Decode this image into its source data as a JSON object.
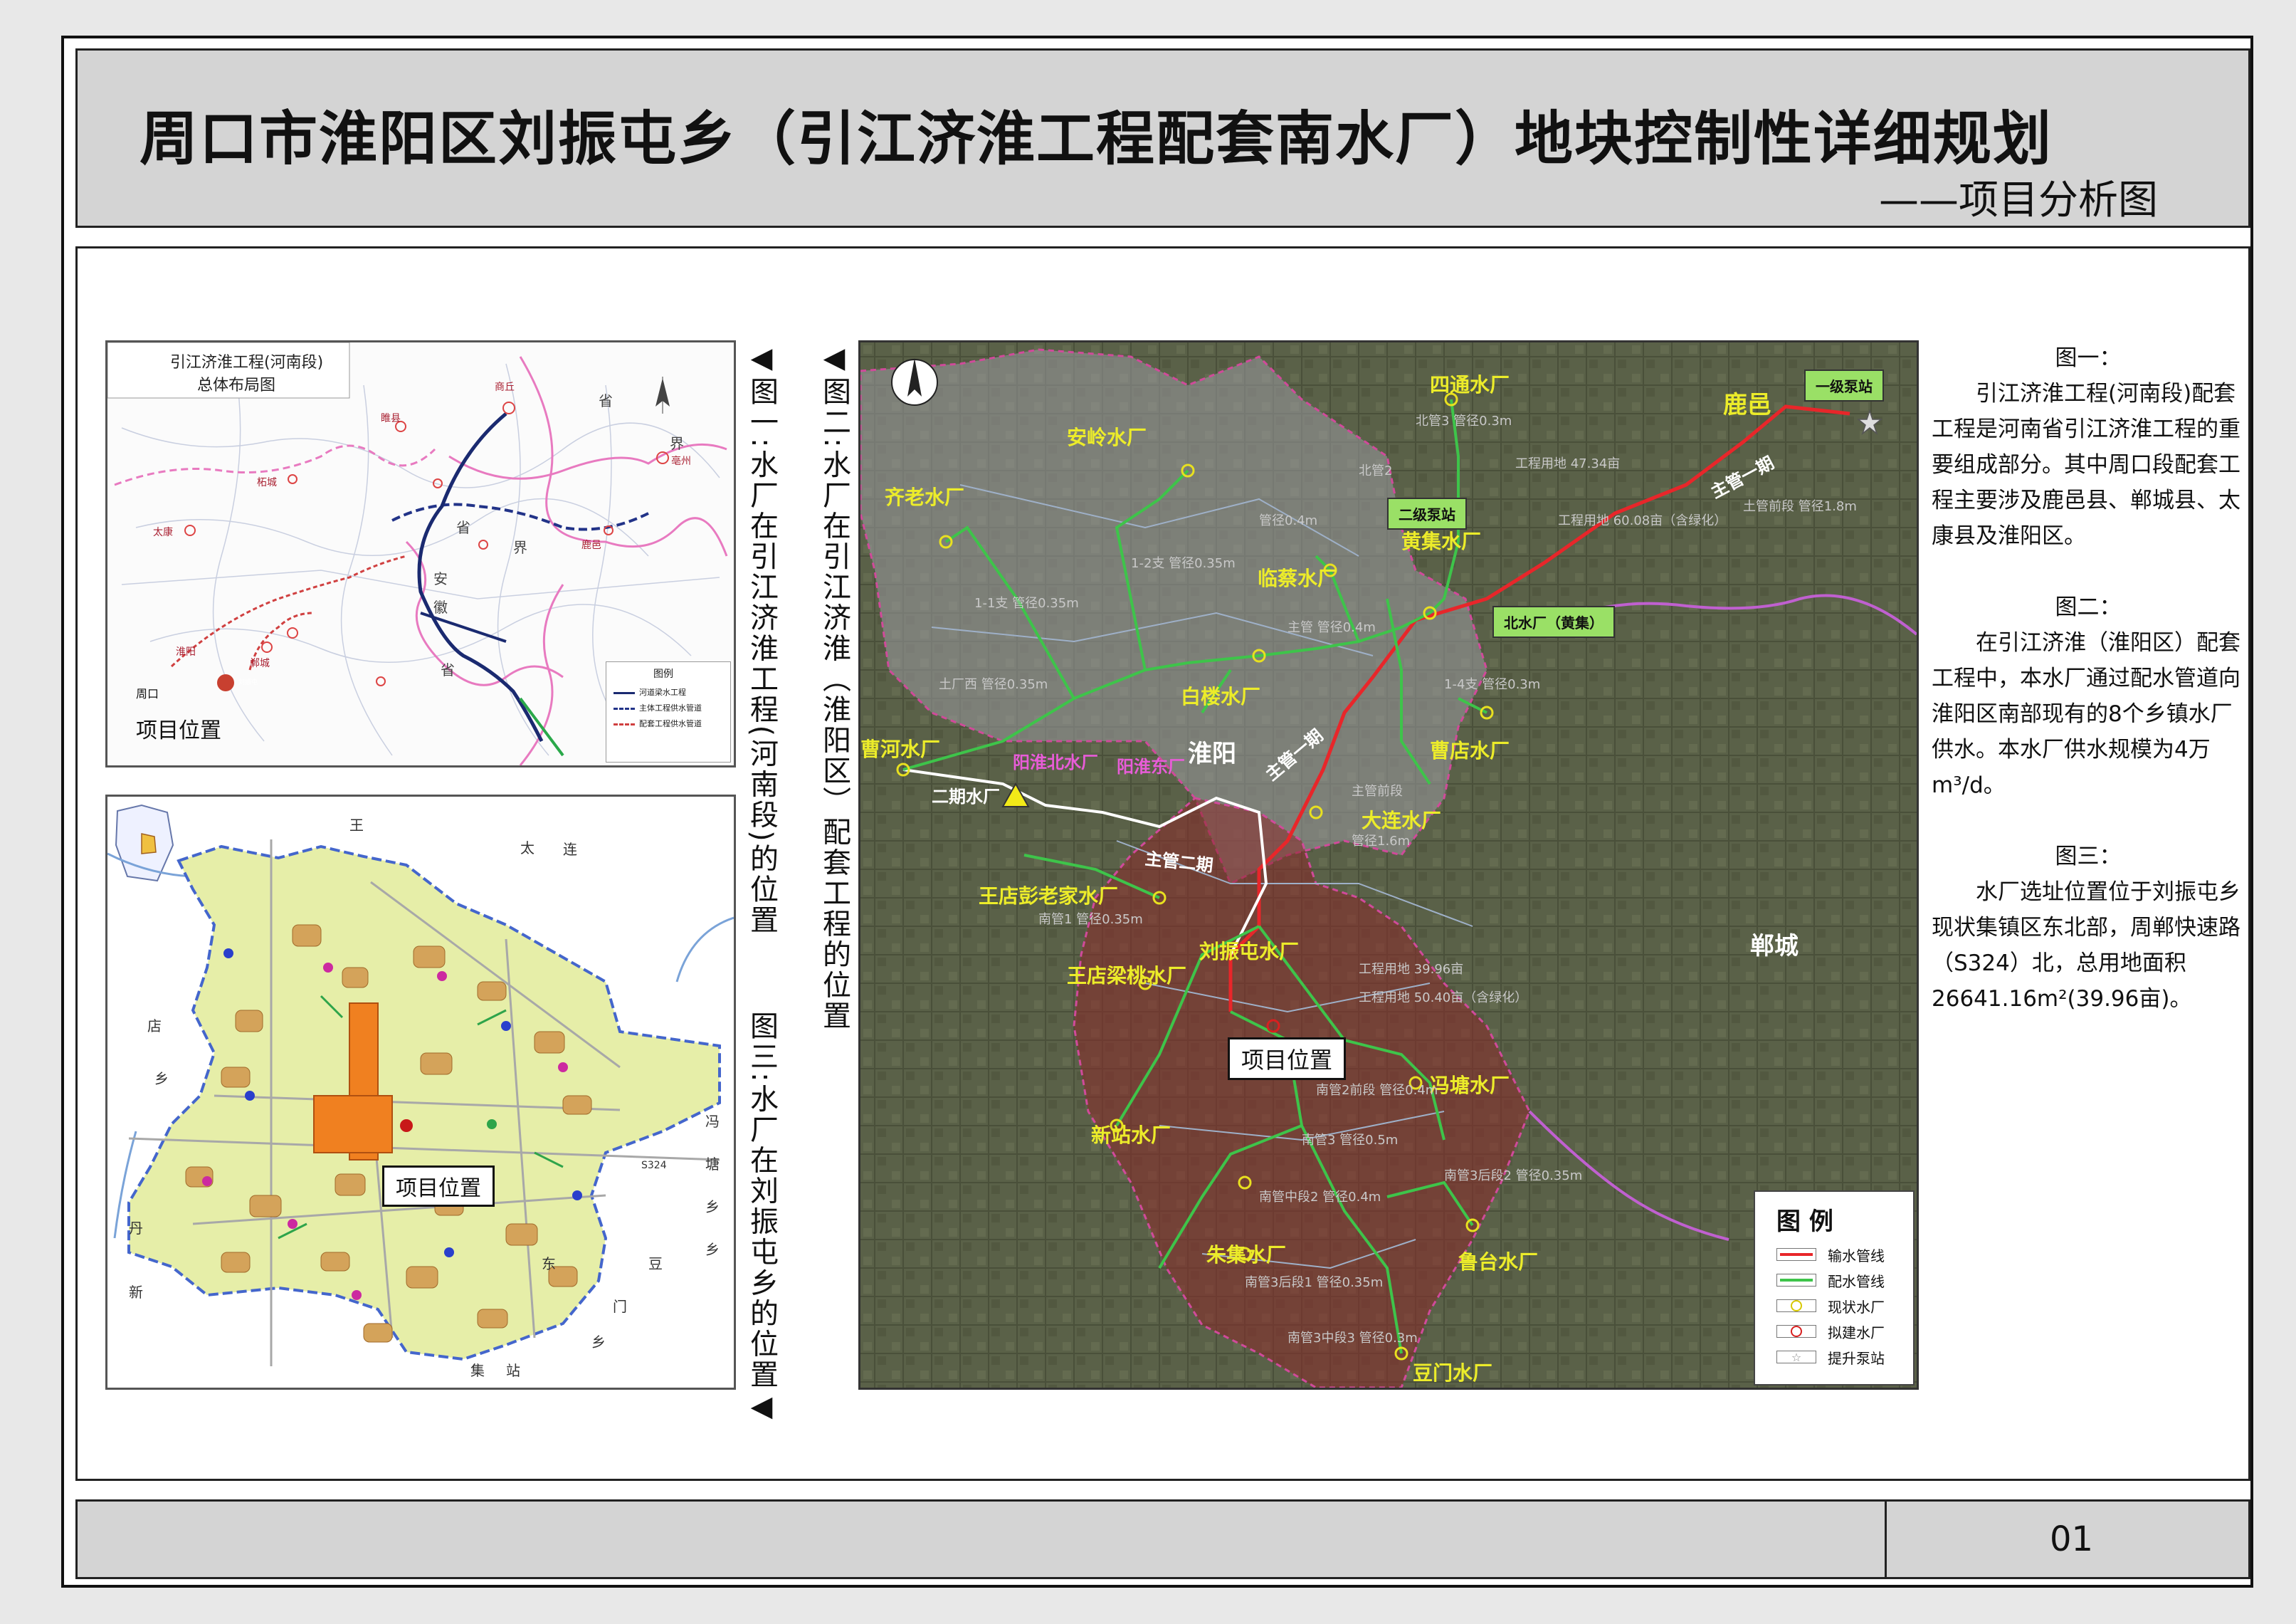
{
  "header": {
    "title": "周口市淮阳区刘振屯乡（引江济淮工程配套南水厂）地块控制性详细规划",
    "subtitle": "——项目分析图"
  },
  "footer": {
    "page_number": "01"
  },
  "captions": {
    "fig1": "◀图一:水厂在引江济淮工程(河南段)的位置",
    "fig2": "◀图二:水厂在引江济淮（淮阳区）配套工程的位置",
    "fig3": "图三:水厂在刘振屯乡的位置◀"
  },
  "fig1_map": {
    "title_line1": "引江济淮工程(河南段)",
    "title_line2": "总体布局图",
    "project_label": "项目位置",
    "legend_title": "图例",
    "legend_items": [
      "河道梁水工程",
      "主体工程供水管道",
      "配套工程供水管道"
    ],
    "province_labels": [
      "省",
      "界",
      "省",
      "安",
      "徽",
      "界",
      "省"
    ],
    "city_labels": [
      "商丘",
      "睢县",
      "柘城",
      "太康",
      "鹿邑",
      "淮阳",
      "周口",
      "郸城",
      "亳州"
    ],
    "small_label": "刘振屯"
  },
  "fig3_map": {
    "project_label": "项目位置",
    "road_label": "S324",
    "edge_chars": [
      "太",
      "王",
      "店",
      "乡",
      "冯",
      "塘",
      "乡",
      "豆",
      "门",
      "乡",
      "新",
      "站",
      "集",
      "东",
      "连",
      "乡",
      "丹"
    ]
  },
  "fig2_map": {
    "city_labels": [
      "淮阳",
      "郸城",
      "鹿邑"
    ],
    "project_label": "项目位置",
    "plant_labels": [
      "四通水厂",
      "安岭水厂",
      "齐老水厂",
      "黄集水厂",
      "临蔡水厂",
      "白楼水厂",
      "曹河水厂",
      "曹店水厂",
      "大连水厂",
      "王店彭老家水厂",
      "王店梁桃水厂",
      "刘振屯水厂",
      "冯塘水厂",
      "新站水厂",
      "朱集水厂",
      "鲁台水厂",
      "豆门水厂"
    ],
    "magenta_labels": [
      "阳淮北水厂",
      "阳淮东厂"
    ],
    "white_labels": [
      "二期水厂"
    ],
    "route_labels": [
      "主管一期",
      "主管一期",
      "主管二期"
    ],
    "tags": [
      "一级泵站",
      "二级泵站",
      "北水厂（黄集）"
    ],
    "pipe_notes": [
      "北管3 管径0.3m",
      "北管2",
      "管径0.4m",
      "1-2支 管径0.35m",
      "1-1支 管径0.35m",
      "主管 管径0.4m",
      "土厂西 管径0.35m",
      "1-4支 管径0.3m",
      "南管1 管径0.35m",
      "土管前段 管径1.8m",
      "主管前段",
      "管径1.6m",
      "南管2前段 管径0.4m",
      "南管3 管径0.5m",
      "南管3后段1 管径0.35m",
      "南管3中段3 管径0.3m",
      "工程用地 47.34亩",
      "工程用地 60.08亩（含绿化）",
      "工程用地 39.96亩",
      "工程用地 50.40亩（含绿化）",
      "南管3后段2 管径0.35m",
      "南管中段2 管径0.4m"
    ]
  },
  "map_legend": {
    "title": "图 例",
    "items": [
      {
        "label": "输水管线",
        "color": "#e8262a"
      },
      {
        "label": "配水管线",
        "color": "#3ec44a"
      },
      {
        "label": "现状水厂",
        "color": "#f0e020"
      },
      {
        "label": "拟建水厂",
        "color": "#d82020"
      },
      {
        "label": "提升泵站",
        "color": "#888888"
      }
    ]
  },
  "description": [
    {
      "heading": "图一：",
      "body": "引江济淮工程(河南段)配套工程是河南省引江济淮工程的重要组成部分。其中周口段配套工程主要涉及鹿邑县、郸城县、太康县及淮阳区。"
    },
    {
      "heading": "图二：",
      "body": "在引江济淮（淮阳区）配套工程中，本水厂通过配水管道向淮阳区南部现有的8个乡镇水厂供水。本水厂供水规模为4万m³/d。"
    },
    {
      "heading": "图三：",
      "body": "水厂选址位置位于刘振屯乡现状集镇区东北部，周郸快速路（S324）北，总用地面积26641.16m²(39.96亩)。"
    }
  ]
}
